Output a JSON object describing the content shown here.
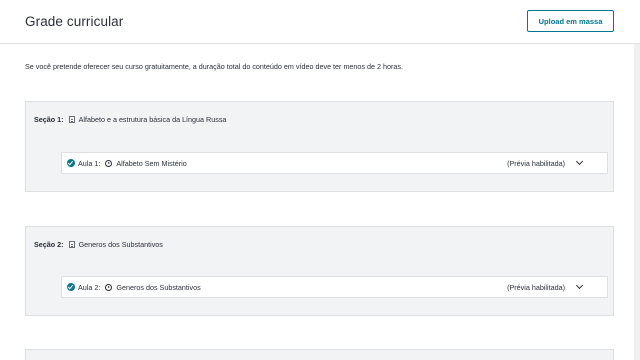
{
  "header": {
    "title": "Grade curricular",
    "bulk_upload_label": "Upload em massa"
  },
  "notice": "Se você pretende oferecer seu curso gratuitamente, a duração total do conteúdo em vídeo deve ter menos de 2 horas.",
  "sections": [
    {
      "label": "Seção 1:",
      "title": "Alfabeto e a estrutura básica da Língua Russa",
      "lecture": {
        "label": "Aula 1:",
        "title": "Alfabeto Sem Mistério",
        "preview": "(Prévia habilitada)"
      }
    },
    {
      "label": "Seção 2:",
      "title": "Generos dos Substantivos",
      "lecture": {
        "label": "Aula 2:",
        "title": "Generos dos Substantivos",
        "preview": "(Prévia habilitada)"
      }
    }
  ],
  "colors": {
    "accent": "#007791",
    "section_bg": "#f2f3f5",
    "border": "#dedfe0"
  }
}
